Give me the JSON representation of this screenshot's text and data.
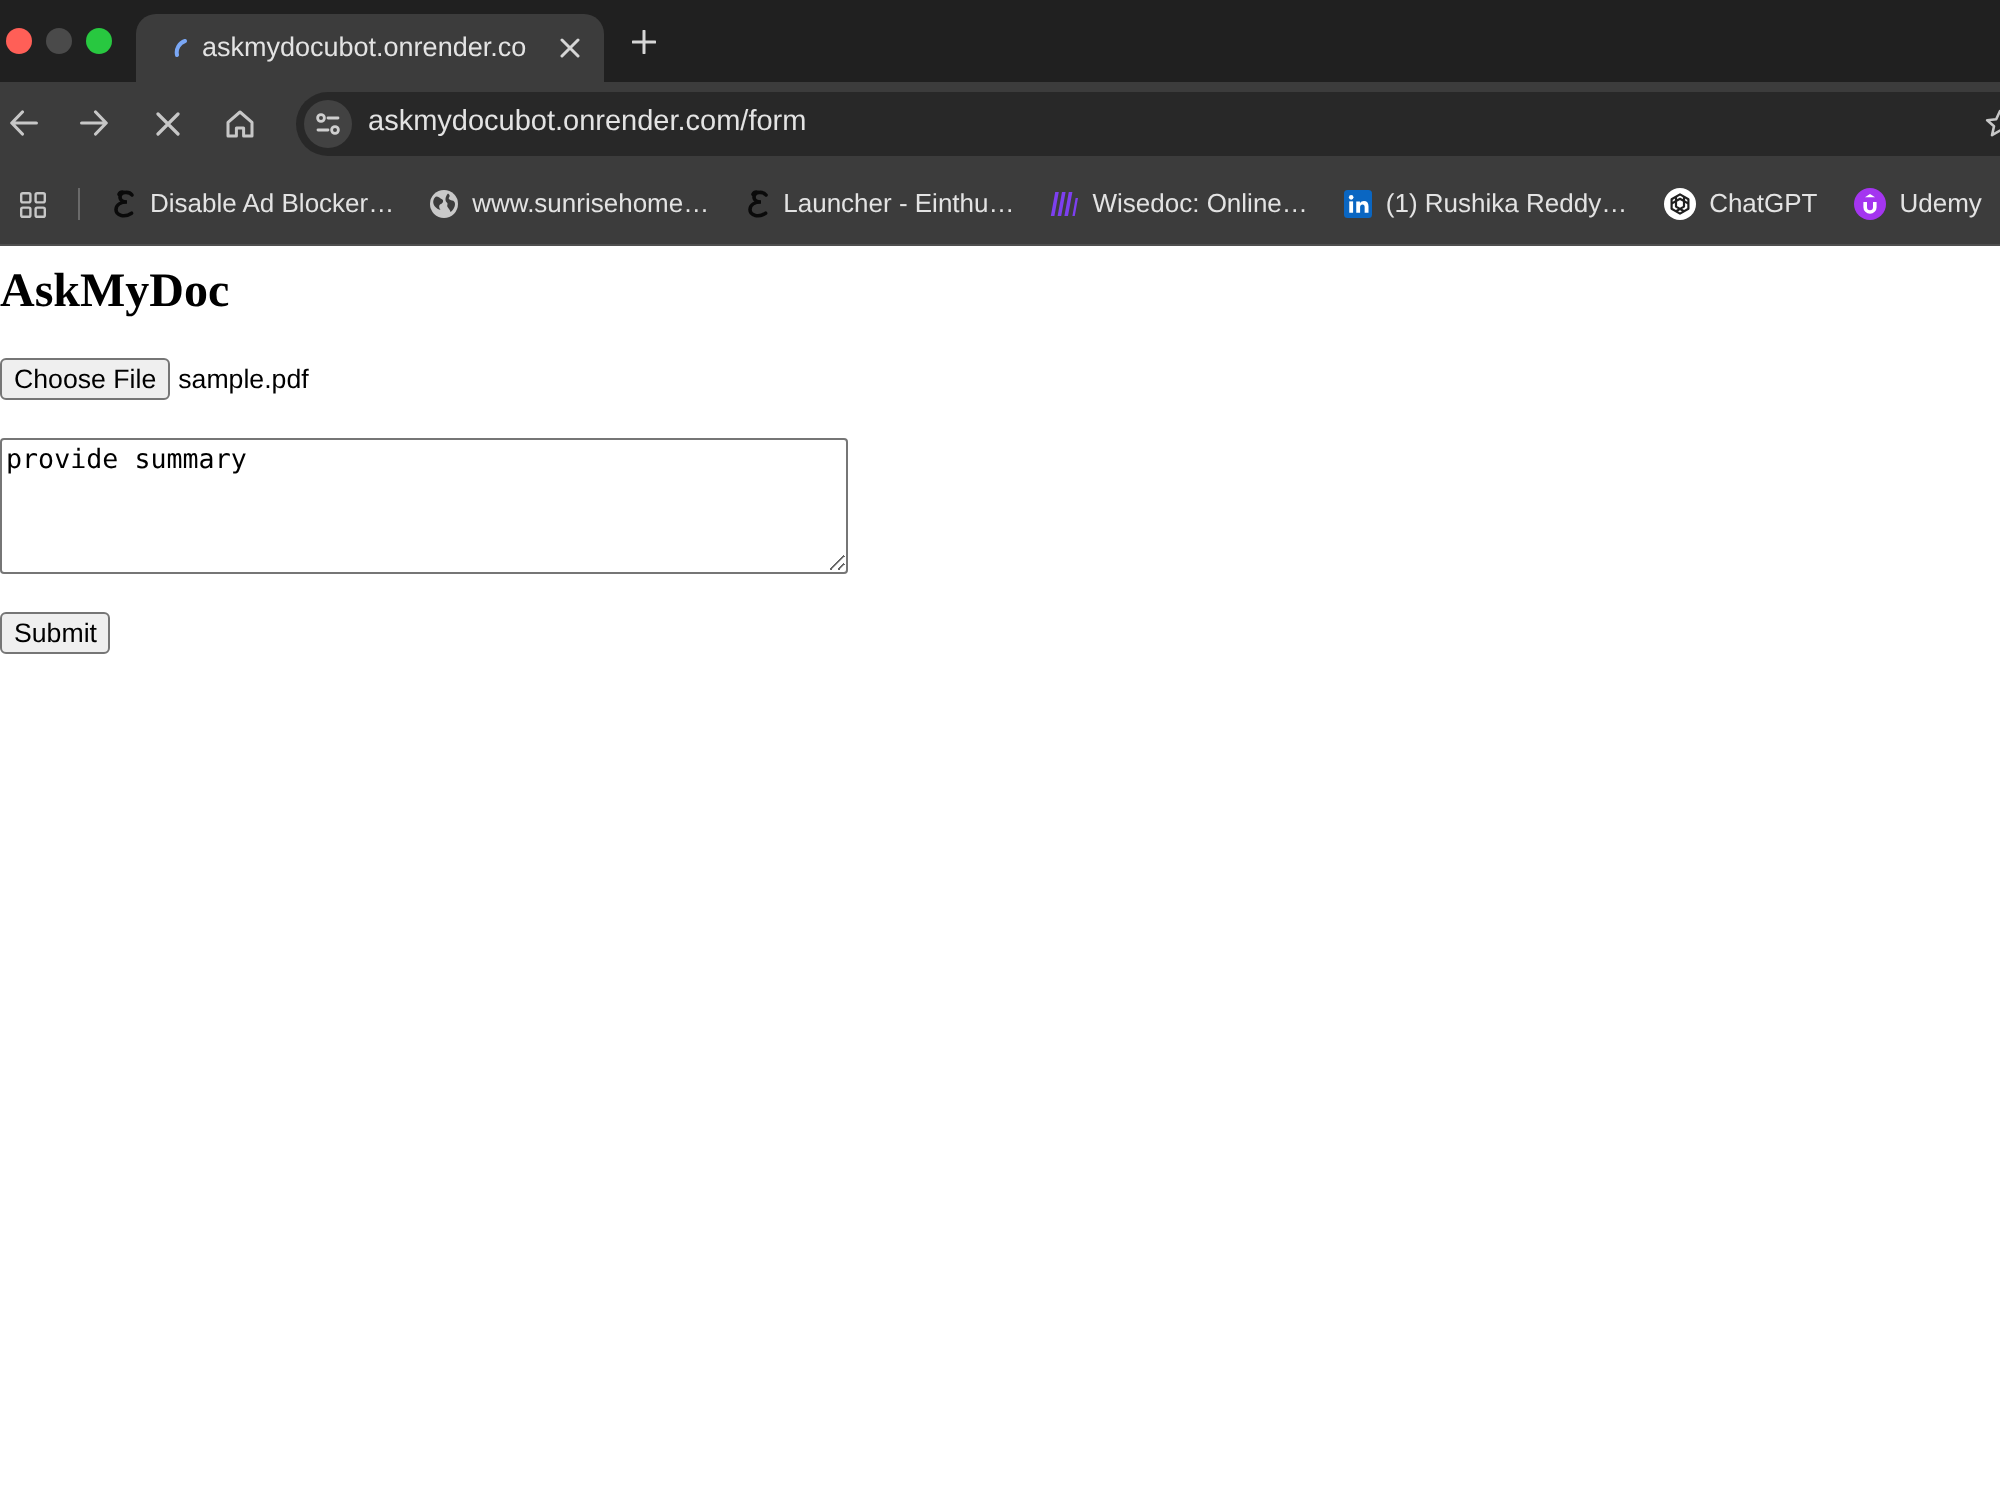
{
  "tabs": [
    {
      "title": "askmydocubot.onrender.co",
      "selected": true,
      "loading": true
    }
  ],
  "address_bar": {
    "url": "askmydocubot.onrender.com/form"
  },
  "bookmarks": [
    {
      "label": "Disable Ad Blocker…"
    },
    {
      "label": "www.sunrisehome…"
    },
    {
      "label": "Launcher - Einthu…"
    },
    {
      "label": "Wisedoc: Online…"
    },
    {
      "label": "(1) Rushika Reddy…"
    },
    {
      "label": "ChatGPT"
    },
    {
      "label": "Udemy"
    }
  ],
  "page": {
    "heading": "AskMyDoc",
    "file_button": "Choose File",
    "file_name": "sample.pdf",
    "question": "provide summary",
    "submit": "Submit"
  }
}
